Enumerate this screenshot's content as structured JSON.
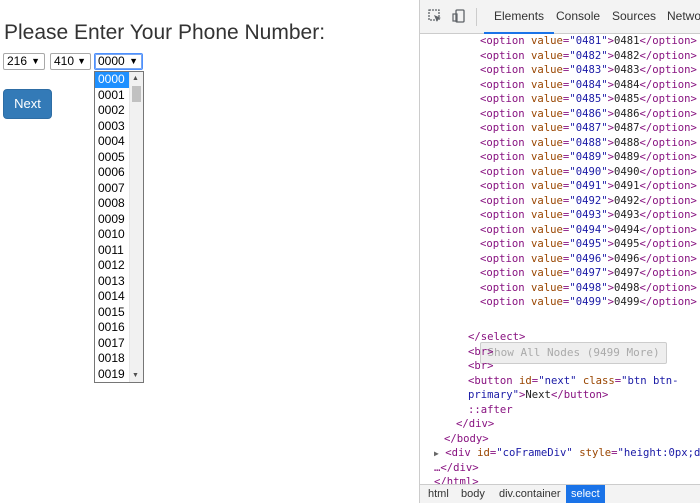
{
  "page": {
    "heading": "Please Enter Your Phone Number:",
    "area_code": "216",
    "prefix": "410",
    "line_number": "0000",
    "dropdown_options": [
      "0000",
      "0001",
      "0002",
      "0003",
      "0004",
      "0005",
      "0006",
      "0007",
      "0008",
      "0009",
      "0010",
      "0011",
      "0012",
      "0013",
      "0014",
      "0015",
      "0016",
      "0017",
      "0018",
      "0019"
    ],
    "selected_option": "0000",
    "next_label": "Next"
  },
  "devtools": {
    "tabs": [
      "Elements",
      "Console",
      "Sources",
      "Netwo"
    ],
    "active_tab": "Elements",
    "options": [
      {
        "value": "0481",
        "text": "0481"
      },
      {
        "value": "0482",
        "text": "0482"
      },
      {
        "value": "0483",
        "text": "0483"
      },
      {
        "value": "0484",
        "text": "0484"
      },
      {
        "value": "0485",
        "text": "0485"
      },
      {
        "value": "0486",
        "text": "0486"
      },
      {
        "value": "0487",
        "text": "0487"
      },
      {
        "value": "0488",
        "text": "0488"
      },
      {
        "value": "0489",
        "text": "0489"
      },
      {
        "value": "0490",
        "text": "0490"
      },
      {
        "value": "0491",
        "text": "0491"
      },
      {
        "value": "0492",
        "text": "0492"
      },
      {
        "value": "0493",
        "text": "0493"
      },
      {
        "value": "0494",
        "text": "0494"
      },
      {
        "value": "0495",
        "text": "0495"
      },
      {
        "value": "0496",
        "text": "0496"
      },
      {
        "value": "0497",
        "text": "0497"
      },
      {
        "value": "0498",
        "text": "0498"
      },
      {
        "value": "0499",
        "text": "0499"
      }
    ],
    "show_all_nodes": "Show All Nodes (9499 More)",
    "after_lines": {
      "select_close": "</select>",
      "br1": "<br>",
      "br2": "<br>",
      "button_open_1": "<button id=\"next\" class=\"btn btn-",
      "button_open_2": "primary\">Next</button>",
      "after_pseudo": "::after",
      "div_close": "</div>",
      "body_close": "</body>",
      "coframe": "<div id=\"coFrameDiv\" style=\"height:0px;di",
      "ellipsis_div_close": "…</div>",
      "html_close": "</html>"
    },
    "breadcrumbs": [
      "html",
      "body",
      "div.container",
      "select"
    ],
    "active_breadcrumb": "select"
  },
  "colors": {
    "button_primary": "#337ab7",
    "selection_blue": "#1e90ff",
    "tag_color": "#881280",
    "attr_color": "#994500",
    "value_color": "#1a1aa6"
  }
}
